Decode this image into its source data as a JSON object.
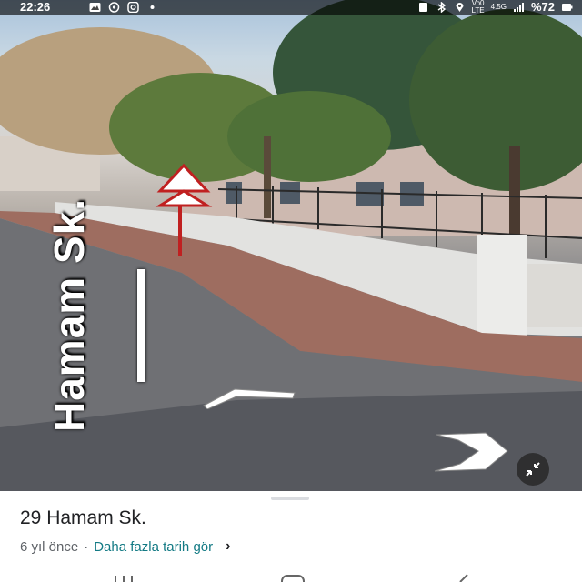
{
  "status_bar": {
    "time": "22:26",
    "carrier_line1": "Vo0",
    "carrier_line2": "LTE",
    "network": "4.5G",
    "battery": "%72",
    "left_icons": [
      "gallery-icon",
      "whatsapp-icon",
      "instagram-icon",
      "dot-icon"
    ],
    "right_icons": [
      "screenshot-icon",
      "bluetooth-icon",
      "location-icon",
      "signal-icon",
      "battery-icon"
    ]
  },
  "street_view": {
    "street_label": "Hamam Sk.",
    "colors": {
      "sky": "#a9c3dc",
      "road": "#6e6f72",
      "sidewalk": "#a06a5c",
      "wall": "#dcdcdc",
      "tree": "#2e4a2c"
    }
  },
  "place": {
    "title": "29 Hamam Sk.",
    "age": "6 yıl önce",
    "separator": "·",
    "more_history_link": "Daha fazla tarih gör",
    "link_color": "#137a84"
  },
  "controls": {
    "exit_icon": "shrink-arrows-icon",
    "nav_arrows": [
      "forward-arrow-icon",
      "right-arrow-icon"
    ],
    "more_icon": "chevron-right-icon"
  },
  "android_nav": [
    "recents-icon",
    "home-icon",
    "back-icon"
  ]
}
